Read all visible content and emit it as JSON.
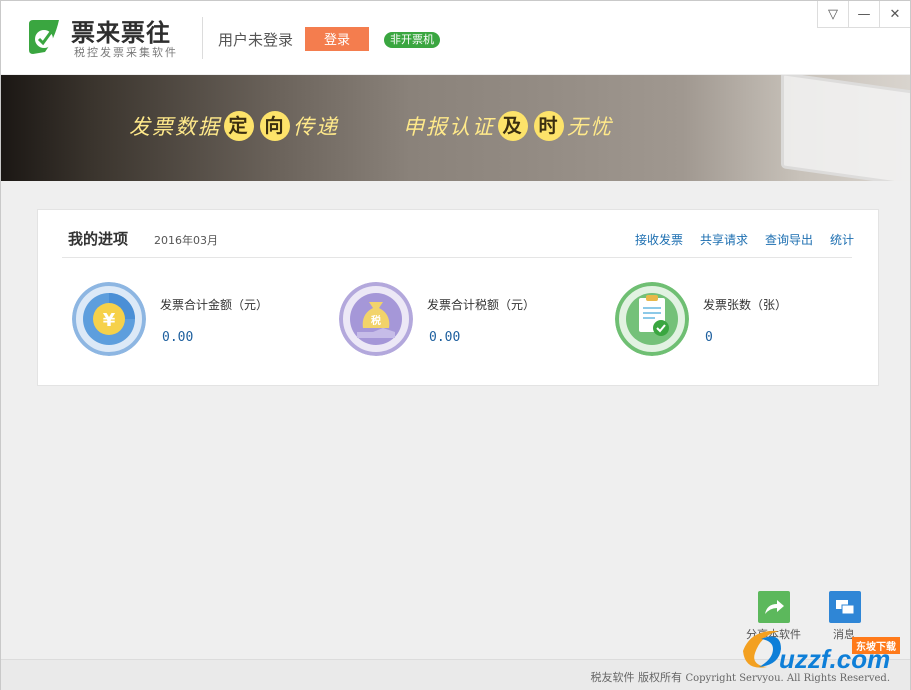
{
  "header": {
    "brand_title": "票来票往",
    "brand_subtitle": "税控发票采集软件",
    "user_status": "用户未登录",
    "login_label": "登录",
    "badge_label": "非开票机",
    "controls": {
      "menu": "▽",
      "minimize": "—",
      "close": "✕"
    }
  },
  "banner": {
    "slogan1_a": "发票数据",
    "slogan1_c1": "定",
    "slogan1_c2": "向",
    "slogan1_b": "传递",
    "slogan2_a": "申报认证",
    "slogan2_c1": "及",
    "slogan2_c2": "时",
    "slogan2_b": "无忧"
  },
  "progress": {
    "title": "我的进项",
    "period": "2016年03月",
    "links": [
      "接收发票",
      "共享请求",
      "查询导出",
      "统计"
    ],
    "stats": [
      {
        "label": "发票合计金额（元）",
        "value": "0.00",
        "icon": "yuan-coin-icon",
        "color": "#4a8fd6"
      },
      {
        "label": "发票合计税额（元）",
        "value": "0.00",
        "icon": "tax-bag-icon",
        "color": "#8a79c9"
      },
      {
        "label": "发票张数（张）",
        "value": "0",
        "icon": "invoice-check-icon",
        "color": "#55b35b"
      }
    ]
  },
  "tools": {
    "share_label": "分享本软件",
    "message_label": "消息"
  },
  "footer": {
    "copyright_cn": "税友软件 版权所有",
    "copyright_en": "Copyright Servyou. All Rights Reserved."
  },
  "watermark": {
    "text": "uzzf.com",
    "tag": "东坡下载"
  }
}
